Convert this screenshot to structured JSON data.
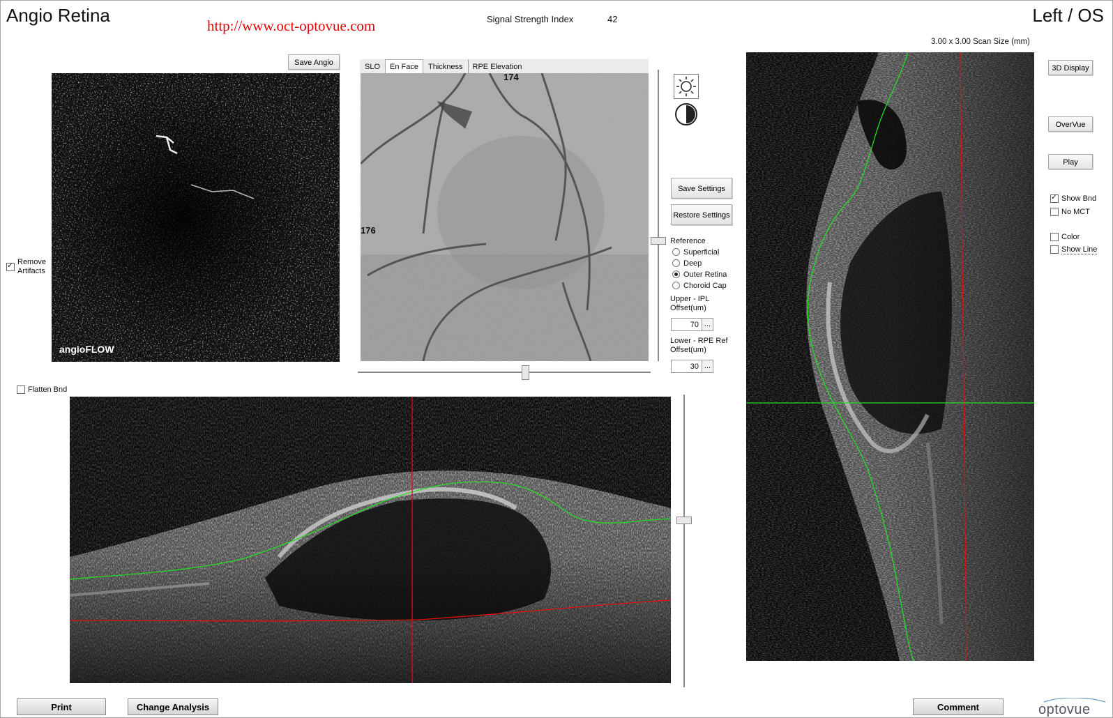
{
  "header": {
    "title": "Angio Retina",
    "url": "http://www.oct-optovue.com",
    "signal_strength_label": "Signal Strength Index",
    "signal_strength_value": "42",
    "eye": "Left / OS",
    "scan_size": "3.00 x 3.00 Scan Size (mm)"
  },
  "angio": {
    "save_label": "Save Angio",
    "logo": "angioFLOW",
    "remove_artifacts_label_1": "Remove",
    "remove_artifacts_label_2": "Artifacts",
    "remove_artifacts_checked": true
  },
  "enface": {
    "tabs": [
      "SLO",
      "En Face",
      "Thickness",
      "RPE Elevation"
    ],
    "active_tab": "En Face",
    "marker_top": "174",
    "marker_left": "176"
  },
  "tools": {
    "brightness_icon": "sun-icon",
    "contrast_icon": "contrast-icon",
    "save_settings": "Save Settings",
    "restore_settings": "Restore Settings",
    "reference_label": "Reference",
    "reference_options": [
      "Superficial",
      "Deep",
      "Outer Retina",
      "Choroid Cap"
    ],
    "reference_selected": "Outer Retina",
    "upper_label_1": "Upper - IPL",
    "upper_label_2": "Offset(um)",
    "upper_value": "70",
    "lower_label_1": "Lower - RPE Ref",
    "lower_label_2": "Offset(um)",
    "lower_value": "30",
    "dots": "..."
  },
  "bscan": {
    "flatten_label": "Flatten Bnd",
    "flatten_checked": false
  },
  "right": {
    "display_3d": "3D Display",
    "overvue": "OverVue",
    "play": "Play",
    "show_bnd": "Show Bnd",
    "show_bnd_checked": true,
    "no_mct": "No MCT",
    "no_mct_checked": false,
    "color": "Color",
    "color_checked": false,
    "show_line": "Show Line",
    "show_line_checked": false
  },
  "footer": {
    "print": "Print",
    "change_analysis": "Change Analysis",
    "comment": "Comment",
    "brand": "optovue"
  },
  "colors": {
    "url_red": "#e00000",
    "boundary_green": "#22dd22",
    "cursor_red": "#e01010"
  }
}
